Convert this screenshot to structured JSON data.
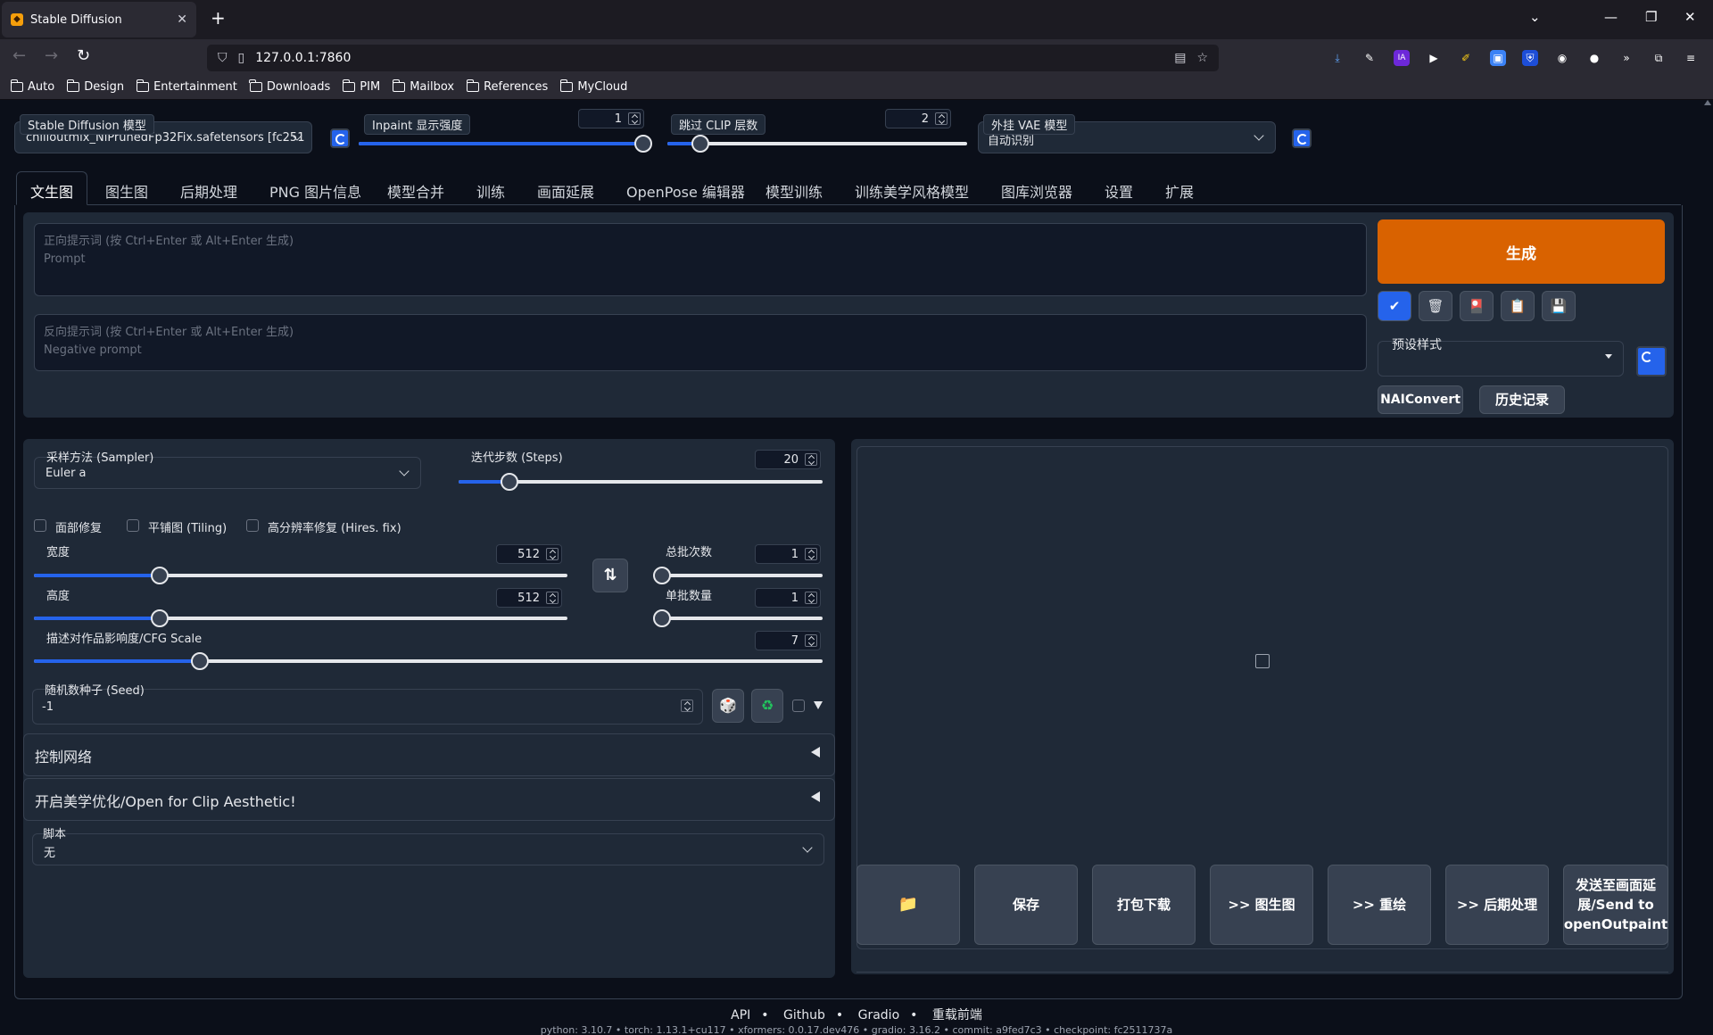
{
  "browser": {
    "tab_title": "Stable Diffusion",
    "url": "127.0.0.1:7860",
    "bookmarks": [
      "Auto",
      "Design",
      "Entertainment",
      "Downloads",
      "PIM",
      "Mailbox",
      "References",
      "MyCloud"
    ]
  },
  "top_controls": {
    "model_label": "Stable Diffusion 模型",
    "model_value": "chilloutmix_NiPrunedFp32Fix.safetensors [fc251",
    "inpaint_label": "Inpaint 显示强度",
    "inpaint_value": "1",
    "inpaint_fraction": 0.98,
    "clip_label": "跳过 CLIP 层数",
    "clip_value": "2",
    "clip_fraction": 0.11,
    "vae_label": "外挂 VAE 模型",
    "vae_value": "自动识别"
  },
  "tabs": [
    "文生图",
    "图生图",
    "后期处理",
    "PNG 图片信息",
    "模型合并",
    "训练",
    "画面延展",
    "OpenPose 编辑器",
    "模型训练",
    "训练美学风格模型",
    "图库浏览器",
    "设置",
    "扩展"
  ],
  "prompt": {
    "positive_placeholder_1": "正向提示词 (按 Ctrl+Enter 或 Alt+Enter 生成)",
    "positive_placeholder_2": "Prompt",
    "negative_placeholder_1": "反向提示词 (按 Ctrl+Enter 或 Alt+Enter 生成)",
    "negative_placeholder_2": "Negative prompt"
  },
  "actions": {
    "generate": "生成",
    "preset_label": "预设样式",
    "naiconvert": "NAIConvert",
    "history": "历史记录"
  },
  "params": {
    "sampler_label": "采样方法 (Sampler)",
    "sampler_value": "Euler a",
    "steps_label": "迭代步数 (Steps)",
    "steps_value": "20",
    "steps_fraction": 0.14,
    "restore_faces": "面部修复",
    "tiling": "平铺图 (Tiling)",
    "hires_fix": "高分辨率修复 (Hires. fix)",
    "width_label": "宽度",
    "width_value": "512",
    "width_fraction": 0.235,
    "height_label": "高度",
    "height_value": "512",
    "height_fraction": 0.235,
    "batch_count_label": "总批次数",
    "batch_count_value": "1",
    "batch_count_fraction": 0.0,
    "batch_size_label": "单批数量",
    "batch_size_value": "1",
    "batch_size_fraction": 0.0,
    "cfg_label": "描述对作品影响度/CFG Scale",
    "cfg_value": "7",
    "cfg_fraction": 0.21,
    "seed_label": "随机数种子 (Seed)",
    "seed_value": "-1",
    "controlnet": "控制网络",
    "aesthetic": "开启美学优化/Open for Clip Aesthetic!",
    "script_label": "脚本",
    "script_value": "无"
  },
  "output_buttons": {
    "folder": "📁",
    "save": "保存",
    "zip": "打包下载",
    "to_img2img": ">> 图生图",
    "to_inpaint": ">> 重绘",
    "to_extras": ">> 后期处理",
    "to_outpaint": "发送至画面延展/Send to openOutpaint"
  },
  "footer": {
    "links": [
      "API",
      "Github",
      "Gradio",
      "重载前端"
    ],
    "build": "python: 3.10.7  •  torch: 1.13.1+cu117  •  xformers: 0.0.17.dev476  •  gradio: 3.16.2  •  commit: a9fed7c3  •  checkpoint: fc2511737a"
  }
}
